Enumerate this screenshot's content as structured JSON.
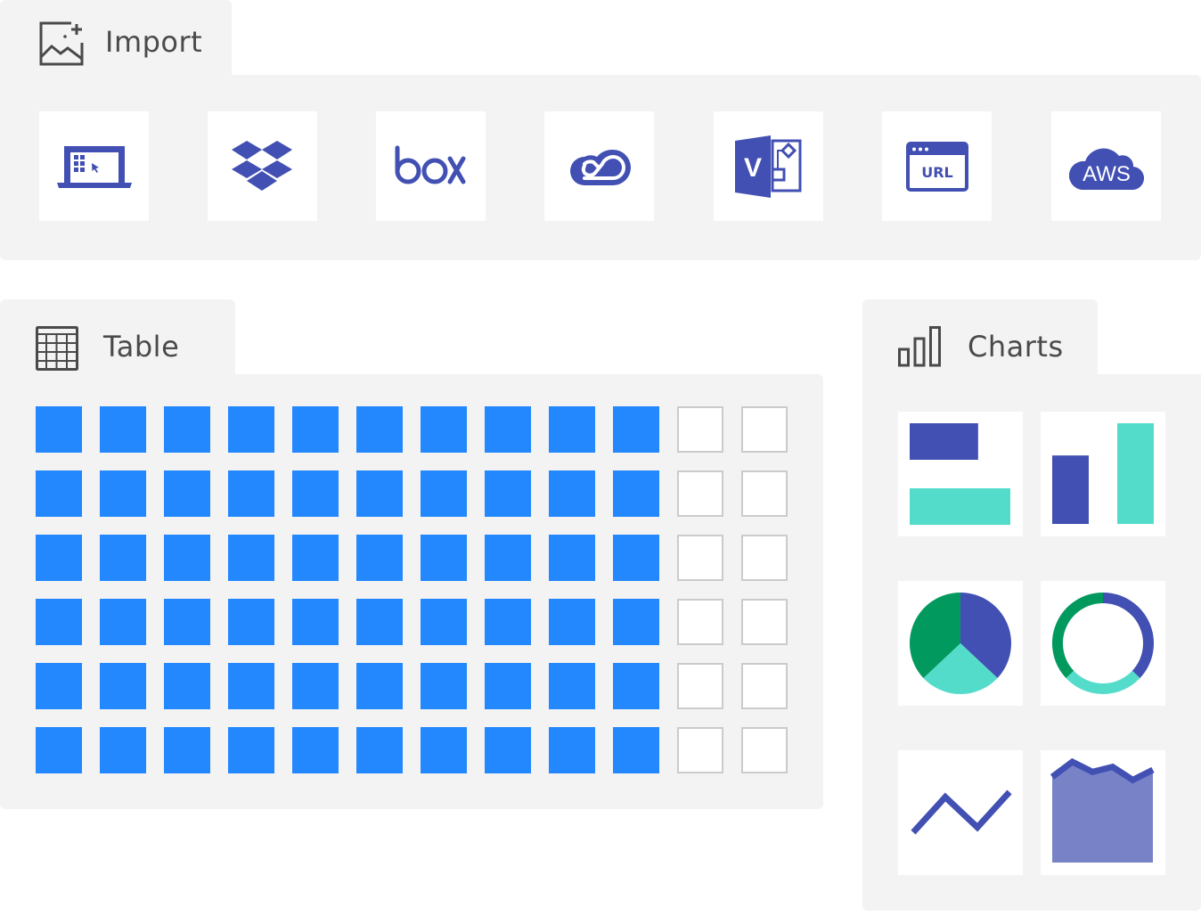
{
  "colors": {
    "panel_bg": "#f3f3f3",
    "icon_indigo": "#4150b2",
    "teal": "#54dccb",
    "green": "#02995f",
    "area_fill": "#7882c7",
    "cell_filled": "#2388fd",
    "cell_empty_border": "#cbcbcb",
    "title_text": "#4a4a4a"
  },
  "import": {
    "title": "Import",
    "icon": "image-add-icon",
    "sources": [
      {
        "name": "local-computer",
        "icon": "laptop-icon"
      },
      {
        "name": "dropbox",
        "icon": "dropbox-icon"
      },
      {
        "name": "box",
        "icon": "box-logo-icon",
        "label": "box"
      },
      {
        "name": "creative-cloud",
        "icon": "creative-cloud-icon"
      },
      {
        "name": "visio",
        "icon": "visio-icon",
        "label": "V"
      },
      {
        "name": "url",
        "icon": "url-browser-icon",
        "label": "URL"
      },
      {
        "name": "aws",
        "icon": "aws-cloud-icon",
        "label": "AWS"
      }
    ]
  },
  "table": {
    "title": "Table",
    "icon": "table-grid-icon",
    "rows": 6,
    "columns": 12,
    "filled_columns": 10
  },
  "charts": {
    "title": "Charts",
    "icon": "bar-chart-icon",
    "types": [
      {
        "name": "horizontal-bar",
        "series": [
          {
            "color": "indigo",
            "value": 0.68
          },
          {
            "color": "teal",
            "value": 1.0
          }
        ]
      },
      {
        "name": "vertical-bar",
        "series": [
          {
            "color": "indigo",
            "value": 0.68
          },
          {
            "color": "teal",
            "value": 1.0
          }
        ]
      },
      {
        "name": "pie",
        "slices": [
          {
            "color": "indigo",
            "percent": 37
          },
          {
            "color": "teal",
            "percent": 26
          },
          {
            "color": "green",
            "percent": 37
          }
        ]
      },
      {
        "name": "donut",
        "slices": [
          {
            "color": "indigo",
            "percent": 37
          },
          {
            "color": "teal",
            "percent": 26
          },
          {
            "color": "green",
            "percent": 37
          }
        ]
      },
      {
        "name": "line",
        "values": [
          0.3,
          0.65,
          0.35,
          0.7
        ]
      },
      {
        "name": "area",
        "values": [
          0.85,
          1.0,
          0.9,
          0.95,
          0.82,
          0.92
        ]
      }
    ]
  }
}
